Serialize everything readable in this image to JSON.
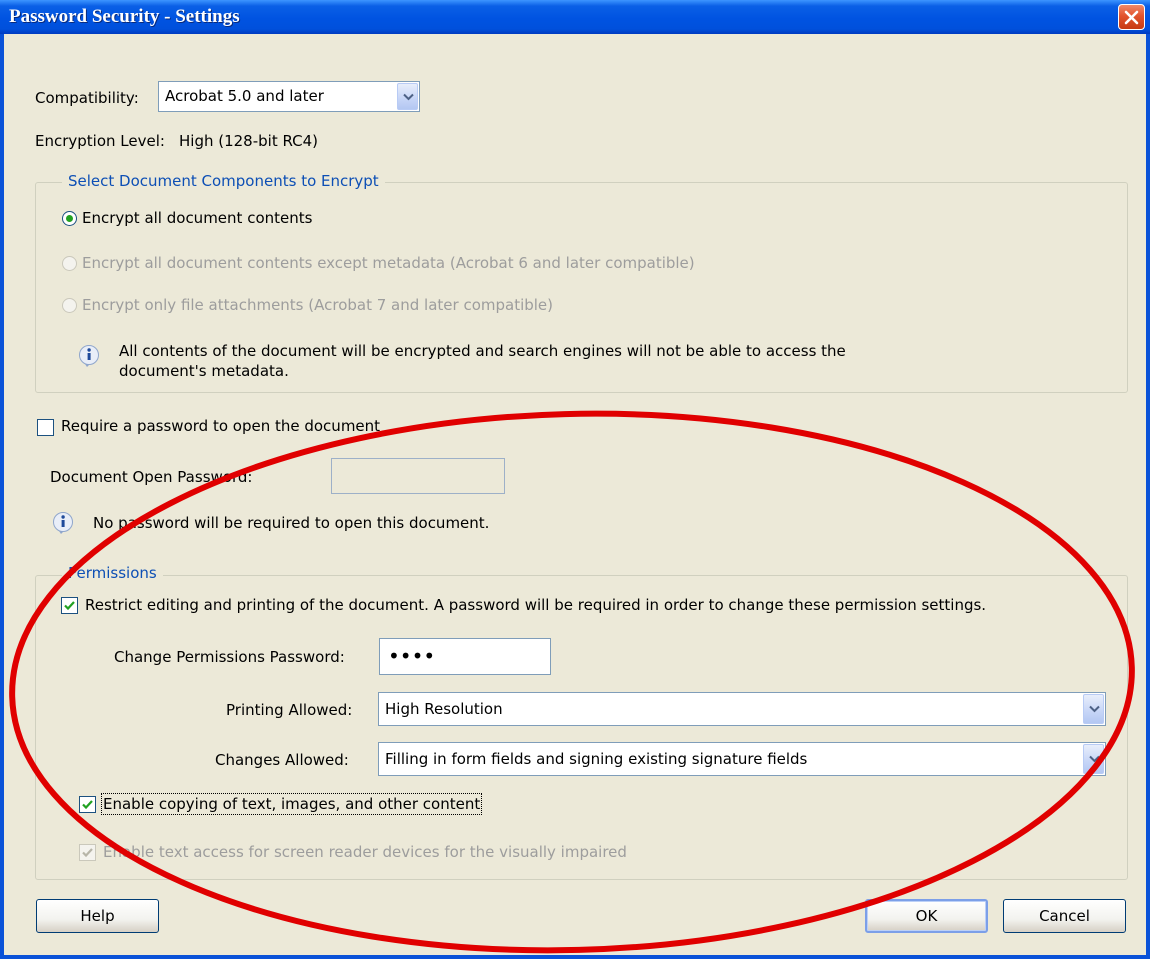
{
  "window": {
    "title": "Password Security - Settings"
  },
  "compatibility": {
    "label": "Compatibility:",
    "value": "Acrobat 5.0 and later"
  },
  "encryption": {
    "label": "Encryption Level:",
    "value": "High (128-bit RC4)"
  },
  "components_group": {
    "title": "Select Document Components to Encrypt",
    "options": [
      {
        "label": "Encrypt all document contents",
        "selected": true,
        "enabled": true
      },
      {
        "label": "Encrypt all document contents except metadata (Acrobat 6 and later compatible)",
        "selected": false,
        "enabled": false
      },
      {
        "label": "Encrypt only file attachments (Acrobat 7 and later compatible)",
        "selected": false,
        "enabled": false
      }
    ],
    "info_line1": "All contents of the document will be encrypted and search engines will not be able to access the",
    "info_line2": "document's metadata."
  },
  "open_password": {
    "checkbox_label": "Require a password to open the document",
    "checked": false,
    "field_label": "Document Open Password:",
    "field_value": "",
    "info": "No password will be required to open this document."
  },
  "permissions": {
    "title": "Permissions",
    "restrict_label": "Restrict editing and printing of the document. A password will be required in order to change these permission settings.",
    "restrict_checked": true,
    "password_label": "Change Permissions Password:",
    "password_value": "••••",
    "printing_label": "Printing Allowed:",
    "printing_value": "High Resolution",
    "changes_label": "Changes Allowed:",
    "changes_value": "Filling in form fields and signing existing signature fields",
    "copy_label": "Enable copying of text, images, and other content",
    "copy_checked": true,
    "screenreader_label": "Enable text access for screen reader devices for the visually impaired",
    "screenreader_checked": true
  },
  "buttons": {
    "help": "Help",
    "ok": "OK",
    "cancel": "Cancel"
  },
  "colors": {
    "annotation_circle": "#e00000",
    "title_bar": "#0053e1",
    "dialog_bg": "#ece9d8"
  }
}
